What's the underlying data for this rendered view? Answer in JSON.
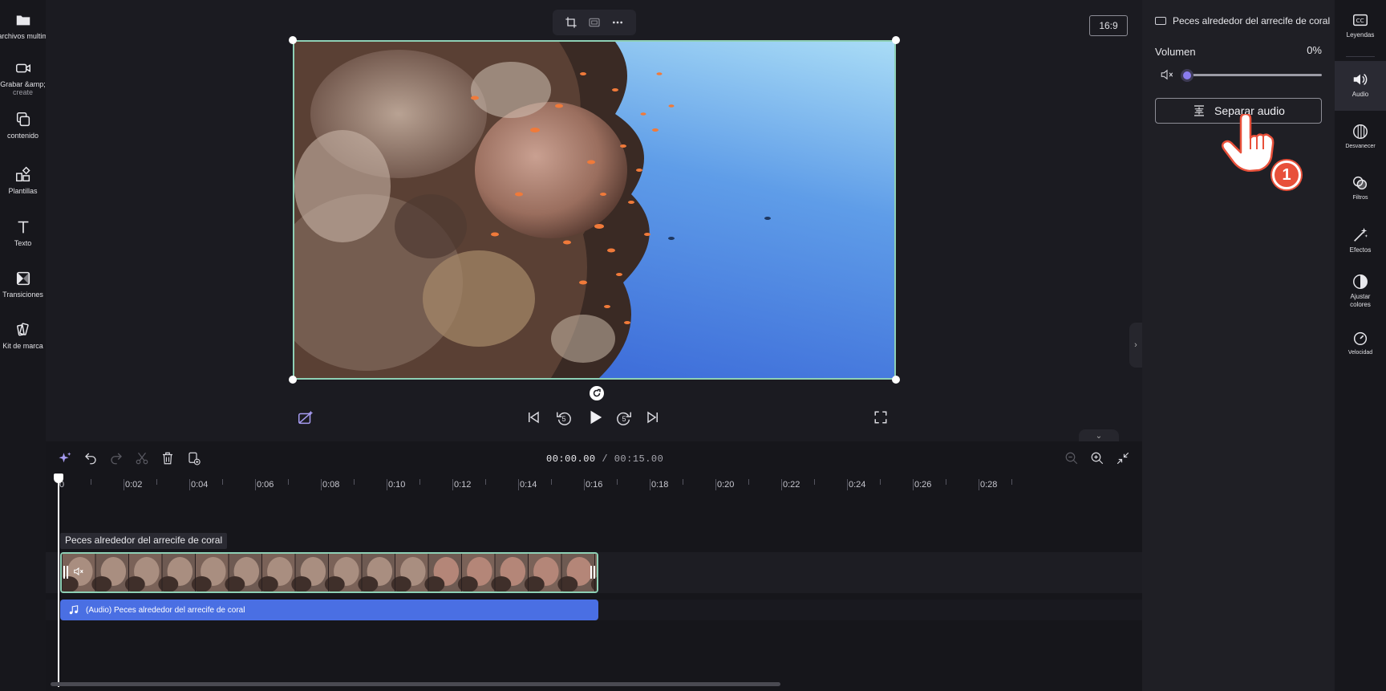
{
  "left_sidebar": {
    "items": [
      {
        "label": "Tus archivos multimedia",
        "icon": "folder-icon"
      },
      {
        "label": "Grabar &amp;",
        "sublabel": "create",
        "icon": "camera-icon"
      },
      {
        "label": "contenido",
        "icon": "content-library-icon"
      },
      {
        "label": "Plantillas",
        "icon": "templates-icon"
      },
      {
        "label": "Texto",
        "icon": "text-icon"
      },
      {
        "label": "Transiciones",
        "icon": "transitions-icon"
      },
      {
        "label": "Kit de marca",
        "icon": "brand-kit-icon"
      }
    ]
  },
  "stage": {
    "aspect_ratio": "16:9",
    "toolbar_icons": [
      "crop-icon",
      "fit-icon",
      "more-icon"
    ],
    "playback_icons": [
      "remove-background-icon",
      "skip-back-icon",
      "rewind-5-icon",
      "play-icon",
      "forward-5-icon",
      "skip-forward-icon",
      "fullscreen-icon"
    ],
    "rewind_label": "5",
    "forward_label": "5"
  },
  "properties": {
    "clip_title": "Peces alrededor del arrecife de coral",
    "volume_label": "Volumen",
    "volume_value": "0%",
    "volume_level": 0,
    "detach_audio_label": "Separar audio"
  },
  "right_rail": {
    "items": [
      {
        "label": "Leyendas",
        "icon": "captions-icon"
      },
      {
        "label": "Audio",
        "icon": "speaker-icon",
        "active": true
      },
      {
        "label": "Desvanecer",
        "icon": "fade-icon"
      },
      {
        "label": "Filtros",
        "icon": "filters-icon"
      },
      {
        "label": "Efectos",
        "icon": "effects-icon"
      },
      {
        "label": "Ajustar",
        "label2": "colores",
        "icon": "adjust-colors-icon"
      },
      {
        "label": "Velocidad",
        "icon": "speed-icon"
      }
    ]
  },
  "timeline": {
    "current_time": "00:00.00",
    "total_time": "/ 00:15.00",
    "ruler_labels": [
      "0",
      "0:02",
      "0:04",
      "0:06",
      "0:08",
      "0:10",
      "0:12",
      "0:14",
      "0:16",
      "0:18",
      "0:20",
      "0:22",
      "0:24",
      "0:26",
      "0:28"
    ],
    "video_clip_label": "Peces alrededor del arrecife de coral",
    "audio_clip_label": "(Audio) Peces alrededor del arrecife de coral"
  },
  "annotation": {
    "step_number": "1"
  },
  "colors": {
    "accent": "#8a7cf0",
    "clip_border": "#8ed0b5",
    "audio_clip": "#4a6fe3",
    "step_badge": "#e8503a"
  }
}
